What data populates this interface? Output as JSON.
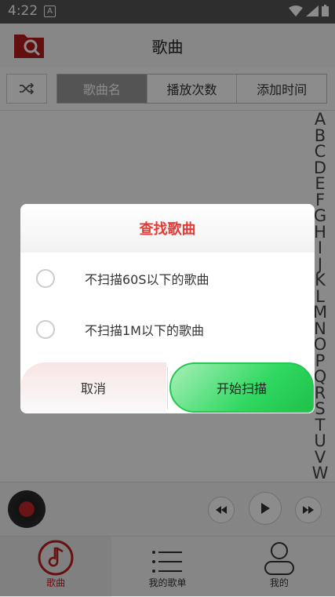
{
  "status": {
    "time": "4:22",
    "notif": "A"
  },
  "header": {
    "title": "歌曲"
  },
  "tabs": {
    "items": [
      "歌曲名",
      "播放次数",
      "添加时间"
    ]
  },
  "index_letters": [
    "A",
    "B",
    "C",
    "D",
    "E",
    "F",
    "G",
    "H",
    "I",
    "J",
    "K",
    "L",
    "M",
    "N",
    "O",
    "P",
    "Q",
    "R",
    "S",
    "T",
    "U",
    "V",
    "W"
  ],
  "dialog": {
    "title": "查找歌曲",
    "options": [
      "不扫描60S以下的歌曲",
      "不扫描1M以下的歌曲"
    ],
    "cancel_label": "取消",
    "start_label": "开始扫描"
  },
  "nav": {
    "songs": "歌曲",
    "playlists": "我的歌单",
    "mine": "我的"
  },
  "colors": {
    "accent": "#e53935",
    "start_button": "#2fd860",
    "active_tab": "#9a9a9a"
  }
}
